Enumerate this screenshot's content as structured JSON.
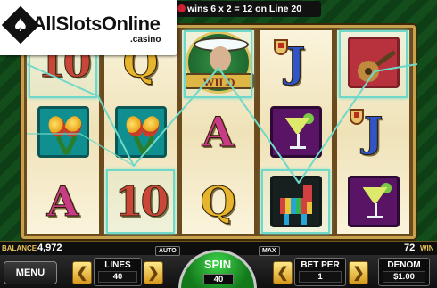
{
  "win_message": "wins 6 x 2 = 12 on Line 20",
  "logo": {
    "brand": "AllSlotsOnline",
    "suffix": ".casino"
  },
  "reels": [
    [
      "10",
      "maracas",
      "A"
    ],
    [
      "Q",
      "maracas",
      "10"
    ],
    [
      "WILD",
      "A",
      "Q"
    ],
    [
      "J",
      "margarita",
      "pinata"
    ],
    [
      "guitar",
      "J",
      "margarita"
    ]
  ],
  "wild_label": "WILD",
  "win_line": {
    "number": 20,
    "color": "#6fd9c9"
  },
  "balance": {
    "label": "BALANCE",
    "value": "4,972"
  },
  "lines_total": {
    "value": "72",
    "label": "WIN"
  },
  "controls": {
    "menu": "MENU",
    "lines_label": "LINES",
    "lines_value": "40",
    "auto": "AUTO",
    "max": "MAX",
    "spin_label": "SPIN",
    "spin_value": "40",
    "bet_per_label": "BET PER",
    "bet_per_value": "1",
    "denom_label": "DENOM",
    "denom_value": "$1.00"
  },
  "colors": {
    "win_line": "#6fd9c9",
    "accent_gold": "#e8c45a",
    "spin_green": "#1f9a2a"
  }
}
